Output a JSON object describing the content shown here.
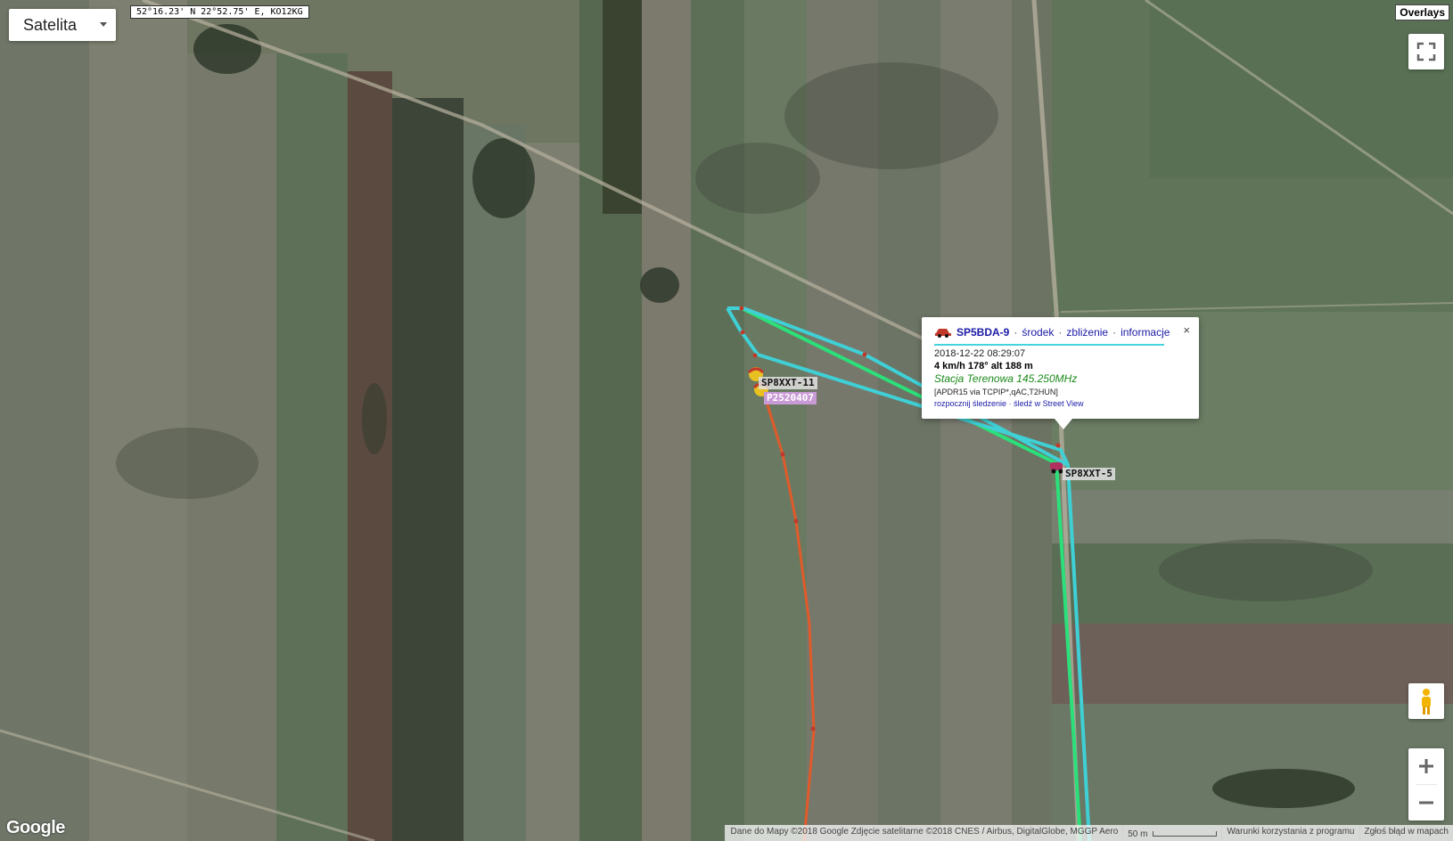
{
  "map_type": {
    "selected": "Satelita"
  },
  "cursor_coords": "52°16.23' N 22°52.75' E, KO12KG",
  "overlays_label": "Overlays",
  "google_logo": "Google",
  "info_window": {
    "callsign": "SP5BDA-9",
    "links": [
      "środek",
      "zbliżenie",
      "informacje"
    ],
    "separator": "·",
    "timestamp": "2018-12-22 08:29:07",
    "motion": "4 km/h 178° alt 188 m",
    "comment": "Stacja Terenowa 145.250MHz",
    "path": "[APDR15 via TCPIP*,qAC,T2HUN]",
    "actions": [
      "rozpocznij śledzenie",
      "śledź w Street View"
    ],
    "close": "×"
  },
  "markers": [
    {
      "label": "SP8XXT-11",
      "icon": "balloon-icon"
    },
    {
      "label": "P2520407",
      "icon": "balloon-icon"
    },
    {
      "label": "SP8XXT-5",
      "icon": "car-icon"
    }
  ],
  "attribution": {
    "data": "Dane do Mapy ©2018 Google Zdjęcie satelitarne ©2018 CNES / Airbus, DigitalGlobe, MGGP Aero",
    "scale": "50 m",
    "terms": "Warunki korzystania z programu",
    "report": "Zgłoś błąd w mapach"
  },
  "colors": {
    "track_cyan": "#3fd0d6",
    "track_orange": "#e05a2a",
    "track_green": "#2be07a",
    "link": "#1a1aa6"
  },
  "controls": {
    "fullscreen": "fullscreen-icon",
    "pegman": "pegman-icon",
    "zoom_in": "+",
    "zoom_out": "−"
  }
}
